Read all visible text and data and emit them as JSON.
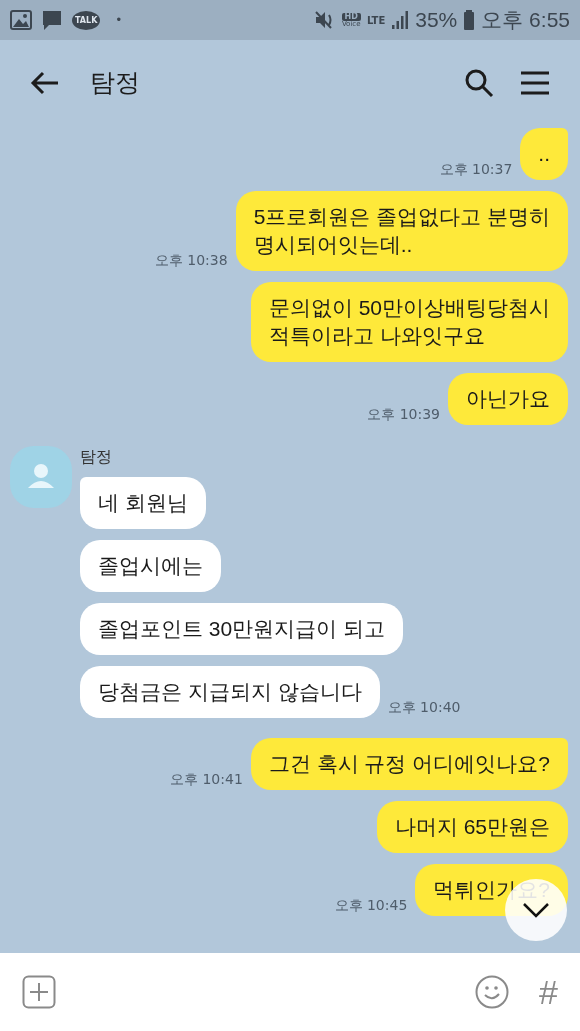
{
  "status_bar": {
    "talk_badge": "TALK",
    "dot": "•",
    "hd": "HD",
    "voice": "Voice",
    "network": "LTE",
    "battery": "35%",
    "time": "오후 6:55"
  },
  "header": {
    "title": "탐정"
  },
  "groups": [
    {
      "kind": "sent",
      "messages": [
        {
          "text": "..",
          "time": "오후 10:37"
        },
        {
          "text": "5프로회원은 졸업없다고 분명히\n명시되어잇는데..",
          "time": "오후 10:38"
        },
        {
          "text": "문의없이 50만이상배팅당첨시\n적특이라고 나와잇구요"
        },
        {
          "text": "아닌가요",
          "time": "오후 10:39"
        }
      ]
    },
    {
      "kind": "received",
      "sender": "탐정",
      "messages": [
        {
          "text": "네 회원님"
        },
        {
          "text": "졸업시에는"
        },
        {
          "text": "졸업포인트 30만원지급이 되고"
        },
        {
          "text": "당첨금은 지급되지 않습니다",
          "time": "오후 10:40"
        }
      ]
    },
    {
      "kind": "sent",
      "messages": [
        {
          "text": "그건 혹시 규정 어디에잇나요?",
          "time": "오후 10:41"
        },
        {
          "text": "나머지 65만원은"
        },
        {
          "text": "먹튀인가요?",
          "time": "오후 10:45"
        }
      ]
    }
  ],
  "input_bar": {
    "hashtag": "#"
  }
}
